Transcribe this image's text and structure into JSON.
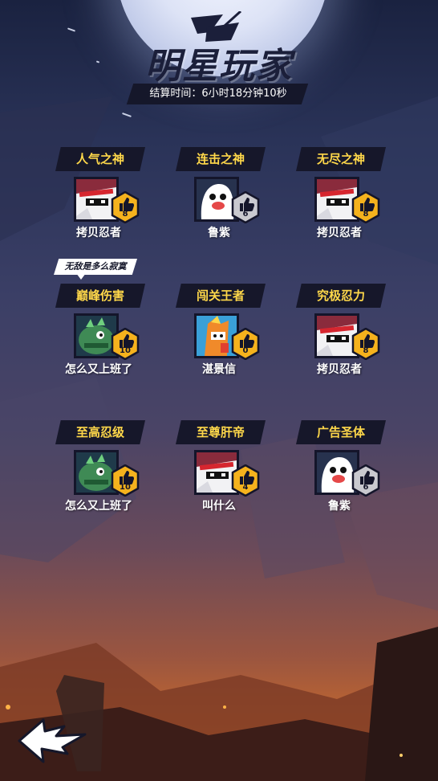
{
  "header": {
    "title": "明星玩家",
    "settlement_time": "结算时间：6小时18分钟10秒"
  },
  "bubble_text": "无敌是多么寂寞",
  "awards": [
    {
      "title": "人气之神",
      "player": "拷贝忍者",
      "likes": "8",
      "avatar": "white-ninja",
      "badge": "gold"
    },
    {
      "title": "连击之神",
      "player": "鲁紫",
      "likes": "6",
      "avatar": "ghost",
      "badge": "gray"
    },
    {
      "title": "无尽之神",
      "player": "拷贝忍者",
      "likes": "8",
      "avatar": "white-ninja",
      "badge": "gold"
    },
    {
      "title": "巅峰伤害",
      "player": "怎么又上班了",
      "likes": "10",
      "avatar": "green-monster",
      "badge": "gold"
    },
    {
      "title": "闯关王者",
      "player": "湛景信",
      "likes": "0",
      "avatar": "orange-hero",
      "badge": "gold"
    },
    {
      "title": "究极忍力",
      "player": "拷贝忍者",
      "likes": "8",
      "avatar": "white-ninja",
      "badge": "gold"
    },
    {
      "title": "至高忍级",
      "player": "怎么又上班了",
      "likes": "10",
      "avatar": "green-monster",
      "badge": "gold"
    },
    {
      "title": "至尊肝帝",
      "player": "叫什么",
      "likes": "4",
      "avatar": "white-ninja",
      "badge": "gold"
    },
    {
      "title": "广告圣体",
      "player": "鲁紫",
      "likes": "6",
      "avatar": "ghost",
      "badge": "gray"
    }
  ],
  "colors": {
    "banner": "#16172a",
    "banner_text": "#ffd84a",
    "badge_gold": "#f5b21d",
    "badge_gray": "#c9c9cf"
  },
  "icons": {
    "like": "thumbs-up-icon",
    "back": "back-arrow-icon"
  }
}
